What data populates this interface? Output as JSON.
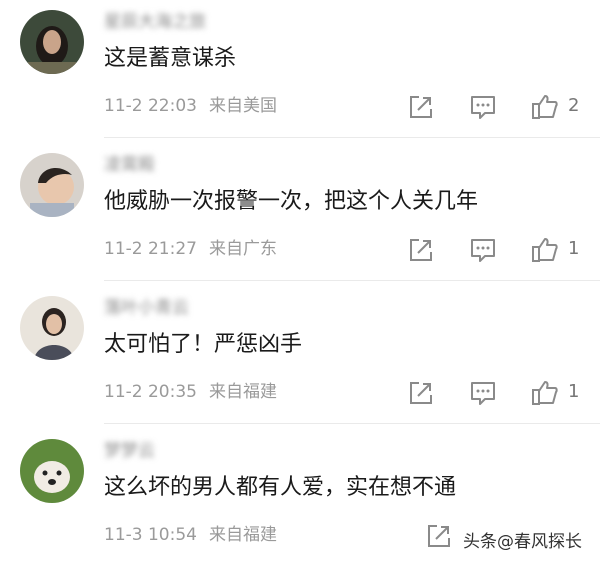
{
  "comments": [
    {
      "username": "星辰大海之旅",
      "text": "这是蓄意谋杀",
      "date": "11-2 22:03",
      "location": "来自美国",
      "likes": "2"
    },
    {
      "username": "凌霄殿",
      "text": "他威胁一次报警一次，把这个人关几年",
      "date": "11-2 21:27",
      "location": "来自广东",
      "likes": "1"
    },
    {
      "username": "落叶小青云",
      "text": "太可怕了！严惩凶手",
      "date": "11-2 20:35",
      "location": "来自福建",
      "likes": "1"
    },
    {
      "username": "梦梦云",
      "text": "这么坏的男人都有人爱，实在想不通",
      "date": "11-3 10:54",
      "location": "来自福建",
      "likes": ""
    }
  ],
  "watermark": "头条@春风探长",
  "icons": {
    "share": "share-icon",
    "reply": "reply-icon",
    "like": "thumbs-up-icon"
  },
  "colors": {
    "text": "#1a1a1a",
    "meta": "#9a9a9a",
    "icon": "#8a8a8a"
  }
}
